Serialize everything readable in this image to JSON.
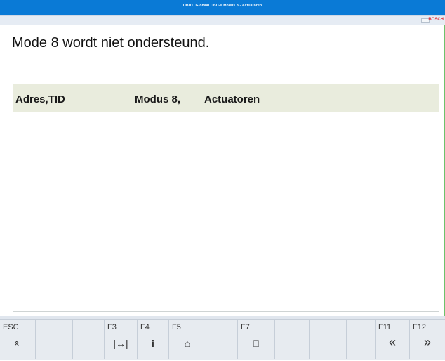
{
  "window": {
    "title": "OBD1, Globaal OBD-II Modus 8 - Actuatoren",
    "brand": "BOSCH"
  },
  "message": {
    "text": "Mode 8 wordt niet ondersteund."
  },
  "table": {
    "columns": [
      "Adres,TID",
      "Modus 8,",
      "Actuatoren"
    ],
    "rows": []
  },
  "function_keys": [
    {
      "key": "ESC",
      "icon": "chevron-double-up-icon",
      "glyph": "«"
    },
    {
      "key": "",
      "icon": "",
      "glyph": ""
    },
    {
      "key": "F3",
      "icon": "measure-icon",
      "glyph": "|↔|"
    },
    {
      "key": "F4",
      "icon": "info-icon",
      "glyph": "i"
    },
    {
      "key": "F5",
      "icon": "car-icon",
      "glyph": "⌂"
    },
    {
      "key": "",
      "icon": "",
      "glyph": ""
    },
    {
      "key": "F7",
      "icon": "print-icon",
      "glyph": "⎕"
    },
    {
      "key": "",
      "icon": "",
      "glyph": ""
    },
    {
      "key": "",
      "icon": "",
      "glyph": ""
    },
    {
      "key": "",
      "icon": "",
      "glyph": ""
    },
    {
      "key": "F11",
      "icon": "chevron-double-left-icon",
      "glyph": "«"
    },
    {
      "key": "F12",
      "icon": "chevron-double-right-icon",
      "glyph": "»"
    }
  ],
  "colors": {
    "titlebar": "#0a7ad6",
    "frame_border": "#6cc26c",
    "table_header": "#e9ecdd",
    "fkey_bar": "#e7ebf0",
    "brand": "#e0242d"
  }
}
